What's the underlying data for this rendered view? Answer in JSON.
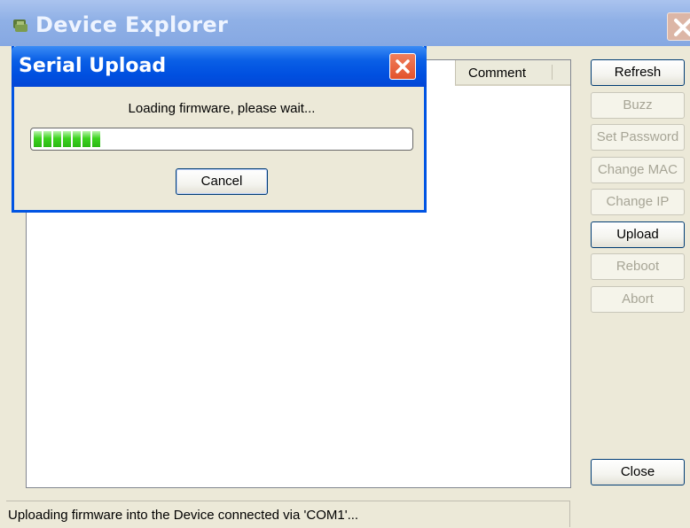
{
  "window": {
    "title": "Device Explorer"
  },
  "device_list": {
    "columns": [
      "Comment"
    ]
  },
  "buttons": [
    {
      "label": "Refresh",
      "enabled": true
    },
    {
      "label": "Buzz",
      "enabled": false
    },
    {
      "label": "Set Password",
      "enabled": false
    },
    {
      "label": "Change MAC",
      "enabled": false
    },
    {
      "label": "Change IP",
      "enabled": false
    },
    {
      "label": "Upload",
      "enabled": true
    },
    {
      "label": "Reboot",
      "enabled": false
    },
    {
      "label": "Abort",
      "enabled": false
    }
  ],
  "close_button": {
    "label": "Close"
  },
  "status_bar": {
    "text": "Uploading firmware into the Device connected via 'COM1'..."
  },
  "dialog": {
    "title": "Serial Upload",
    "message": "Loading firmware, please wait...",
    "progress": 0.18,
    "cancel_label": "Cancel"
  },
  "colors": {
    "accent_blue": "#0054e3",
    "progress_green": "#3cd31f",
    "window_bg": "#ece9d8"
  },
  "icons": [
    "app-icon",
    "close-icon",
    "close-icon"
  ]
}
